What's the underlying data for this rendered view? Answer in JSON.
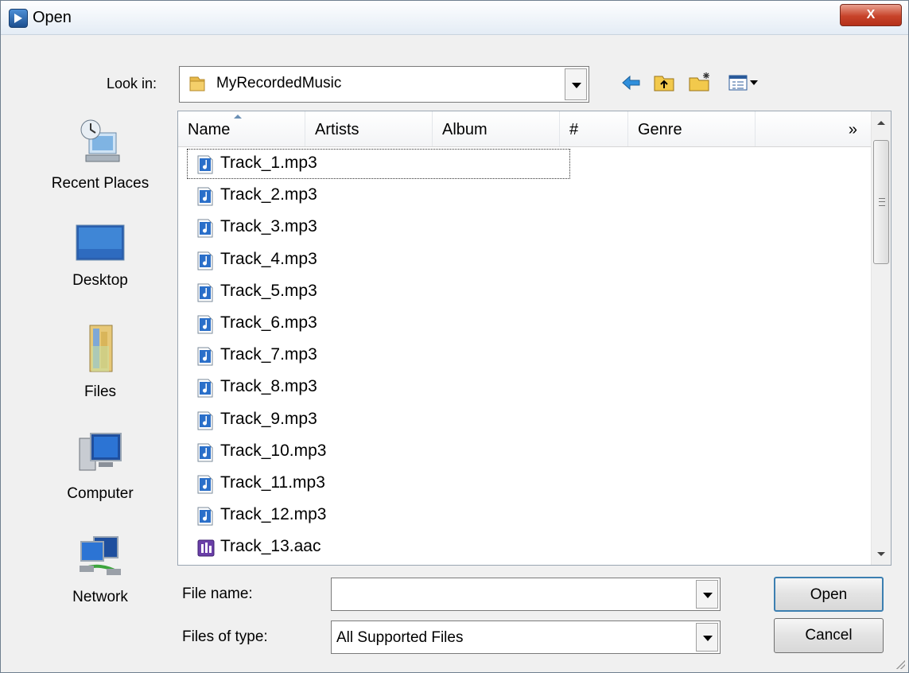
{
  "window": {
    "title": "Open",
    "close_label": "X"
  },
  "lookin": {
    "label": "Look in:",
    "value": "MyRecordedMusic"
  },
  "toolbar": {
    "icons": [
      "back-icon",
      "up-folder-icon",
      "new-folder-icon",
      "view-menu-icon"
    ]
  },
  "places": [
    {
      "label": "Recent Places",
      "icon": "recent-places-icon"
    },
    {
      "label": "Desktop",
      "icon": "desktop-icon"
    },
    {
      "label": "Files",
      "icon": "files-icon"
    },
    {
      "label": "Computer",
      "icon": "computer-icon"
    },
    {
      "label": "Network",
      "icon": "network-icon"
    }
  ],
  "columns": {
    "name": "Name",
    "artists": "Artists",
    "album": "Album",
    "number": "#",
    "genre": "Genre",
    "more": "»"
  },
  "files": [
    {
      "name": "Track_1.mp3",
      "type": "mp3"
    },
    {
      "name": "Track_2.mp3",
      "type": "mp3"
    },
    {
      "name": "Track_3.mp3",
      "type": "mp3"
    },
    {
      "name": "Track_4.mp3",
      "type": "mp3"
    },
    {
      "name": "Track_5.mp3",
      "type": "mp3"
    },
    {
      "name": "Track_6.mp3",
      "type": "mp3"
    },
    {
      "name": "Track_7.mp3",
      "type": "mp3"
    },
    {
      "name": "Track_8.mp3",
      "type": "mp3"
    },
    {
      "name": "Track_9.mp3",
      "type": "mp3"
    },
    {
      "name": "Track_10.mp3",
      "type": "mp3"
    },
    {
      "name": "Track_11.mp3",
      "type": "mp3"
    },
    {
      "name": "Track_12.mp3",
      "type": "mp3"
    },
    {
      "name": "Track_13.aac",
      "type": "aac"
    }
  ],
  "file_name": {
    "label": "File name:",
    "value": ""
  },
  "file_type": {
    "label": "Files of type:",
    "value": "All Supported Files"
  },
  "buttons": {
    "open": "Open",
    "cancel": "Cancel"
  },
  "colors": {
    "accent": "#3c7fb1",
    "close": "#c7432a",
    "music_icon": "#2a6fc9"
  }
}
